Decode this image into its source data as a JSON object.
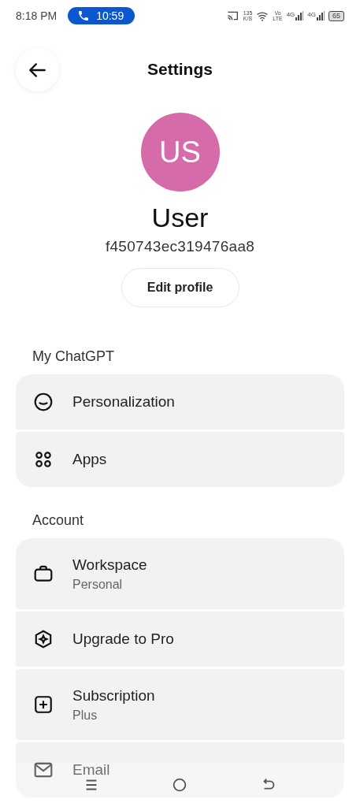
{
  "status_bar": {
    "time": "8:18 PM",
    "call_duration": "10:59",
    "speed": "135",
    "speed_unit": "K/S",
    "volte": [
      "Vo",
      "LTE"
    ],
    "networks": [
      "4G",
      "4G"
    ],
    "battery": "65"
  },
  "header": {
    "title": "Settings"
  },
  "profile": {
    "initials": "US",
    "name": "User",
    "id": "f450743ec319476aa8",
    "edit_button": "Edit profile"
  },
  "sections": [
    {
      "title": "My ChatGPT",
      "items": [
        {
          "kind": "smile",
          "label": "Personalization"
        },
        {
          "kind": "apps",
          "label": "Apps"
        }
      ]
    },
    {
      "title": "Account",
      "items": [
        {
          "kind": "briefcase",
          "label": "Workspace",
          "sublabel": "Personal"
        },
        {
          "kind": "upgrade",
          "label": "Upgrade to Pro"
        },
        {
          "kind": "plus",
          "label": "Subscription",
          "sublabel": "Plus"
        },
        {
          "kind": "mail",
          "label": "Email"
        }
      ]
    }
  ]
}
